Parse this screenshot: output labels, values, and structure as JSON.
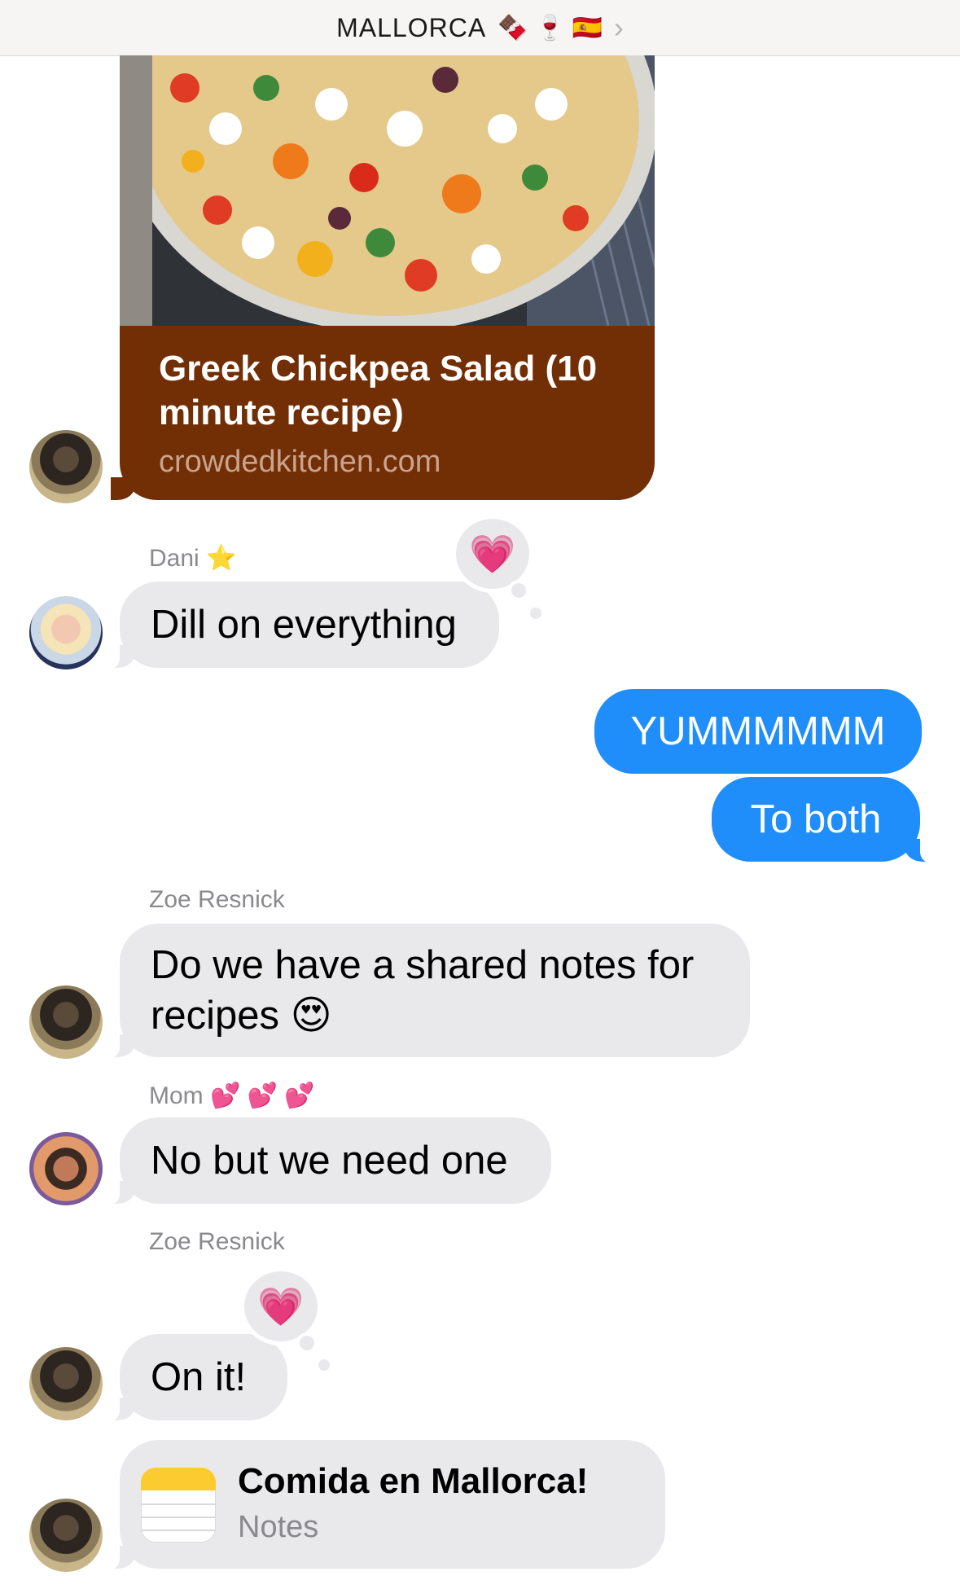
{
  "header": {
    "title": "MALLORCA",
    "emoji": "🍫 🍷 🇪🇸",
    "chevron": "›"
  },
  "link_preview": {
    "title": "Greek Chickpea Salad (10 minute recipe)",
    "domain": "crowdedkitchen.com"
  },
  "messages": {
    "dani": {
      "sender": "Dani ⭐",
      "text": "Dill on everything",
      "tapback": "💗"
    },
    "me1": {
      "text": "YUMMMMMM"
    },
    "me2": {
      "text": "To both"
    },
    "zoe1": {
      "sender": "Zoe Resnick",
      "text": "Do we have a shared notes for recipes 😍"
    },
    "mom": {
      "sender": "Mom 💕 💕 💕",
      "text": "No but we need one"
    },
    "zoe2": {
      "sender": "Zoe Resnick",
      "text": "On it!",
      "tapback": "💗"
    },
    "note": {
      "title": "Comida en Mallorca!",
      "app": "Notes"
    }
  },
  "colors": {
    "blue_bubble": "#1f8efa",
    "gray_bubble": "#e9e9eb",
    "link_footer": "#722f05"
  }
}
